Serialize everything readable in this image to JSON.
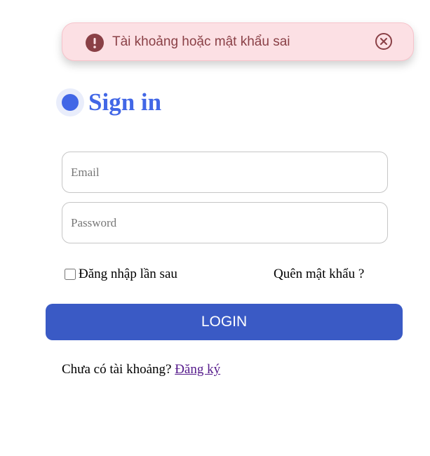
{
  "toast": {
    "message": "Tài khoảng hoặc mật khẩu sai",
    "icon": "exclamation-circle-icon",
    "close_icon": "close-circle-icon",
    "text_color": "#8a4046",
    "background": "#fce0e4"
  },
  "header": {
    "title": "Sign in",
    "accent_color": "#4267e6"
  },
  "form": {
    "email_placeholder": "Email",
    "email_value": "",
    "password_placeholder": "Password",
    "password_value": "",
    "remember_label": "Đăng nhập lần sau",
    "remember_checked": false,
    "forgot_label": "Quên mật khẩu ?",
    "login_label": "LOGIN",
    "button_color": "#3a5ac5"
  },
  "footer": {
    "prompt": "Chưa có tài khoảng?",
    "signup_link": "Đăng ký"
  }
}
